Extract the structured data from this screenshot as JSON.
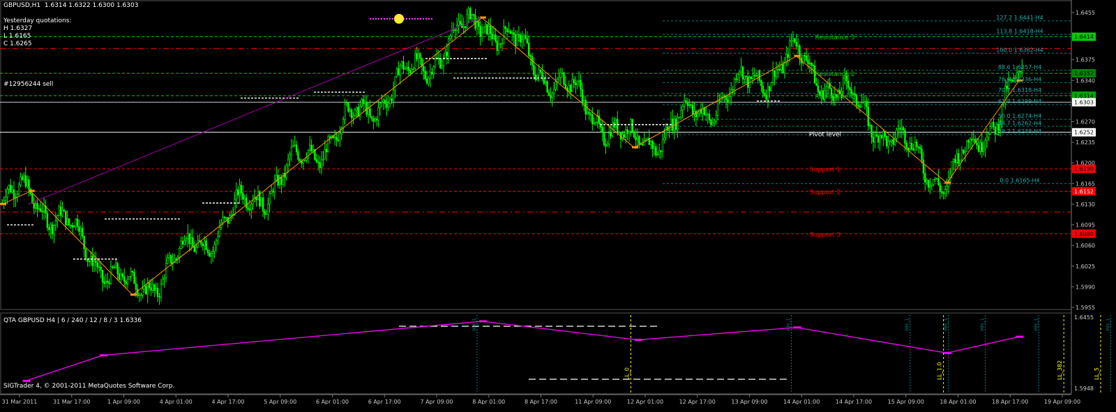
{
  "window": {
    "symbol_header": "GBPUSD,H1  1.6314 1.6322 1.6300 1.6303"
  },
  "yesterday": {
    "title": "Yesterday quotations:",
    "high": "H 1.6327",
    "low": "L 1.6165",
    "close": "C 1.6265"
  },
  "order": {
    "label": "#12956244 sell"
  },
  "colors": {
    "background": "#000000",
    "candle": "#00ff00",
    "zigzag": "#ff9900",
    "resistance": "#00cc00",
    "support": "#ff0000",
    "fib": "#008080",
    "qta_line": "#ff00ff",
    "cycle_yellow": "#ffff00"
  },
  "price_axis": {
    "ticks": [
      "1.6455",
      "1.6414",
      "1.6375",
      "1.6352",
      "1.6340",
      "1.6314",
      "1.6303",
      "1.6270",
      "1.6252",
      "1.6235",
      "1.6200",
      "1.6165",
      "1.6152",
      "1.6130",
      "1.6095",
      "1.6080",
      "1.6060",
      "1.6025",
      "1.5990",
      "1.5955"
    ],
    "highlighted": [
      {
        "value": "1.6414",
        "bg": "#00cc00",
        "fg": "#000000"
      },
      {
        "value": "1.6352",
        "bg": "#008800",
        "fg": "#000000"
      },
      {
        "value": "1.6314",
        "bg": "#00aa00",
        "fg": "#000000"
      },
      {
        "value": "1.6303",
        "bg": "#ffffff",
        "fg": "#000000"
      },
      {
        "value": "1.6252",
        "bg": "#ffffff",
        "fg": "#000000"
      },
      {
        "value": "1.6190",
        "bg": "#ff0000",
        "fg": "#000000"
      },
      {
        "value": "1.6152",
        "bg": "#ff0000",
        "fg": "#ffffff"
      },
      {
        "value": "1.6080",
        "bg": "#ff0000",
        "fg": "#000000"
      }
    ]
  },
  "levels": {
    "resistance": [
      {
        "label": "Resistance 3",
        "price": 1.6414
      },
      {
        "label": "Resistance 2",
        "price": 1.6352
      },
      {
        "label": "Resistance 1",
        "price": 1.6314
      }
    ],
    "pivot": {
      "label": "Pivot level",
      "price": 1.6252
    },
    "support": [
      {
        "label": "Support 1",
        "price": 1.619
      },
      {
        "label": "Support 2",
        "price": 1.6152
      },
      {
        "label": "Support 3",
        "price": 1.608
      }
    ],
    "yesterday_close_red": 1.6394,
    "yesterday_low_red": 1.6117
  },
  "fib": [
    {
      "label": "127.2 1.6441-H4",
      "price": 1.6441
    },
    {
      "label": "113.8 1.6418-H4",
      "price": 1.6418
    },
    {
      "label": "100.0 1.6382-H4",
      "price": 1.6386
    },
    {
      "label": "88.6 1.6357-H4",
      "price": 1.6357
    },
    {
      "label": "78.6 1.6336-H4",
      "price": 1.6336
    },
    {
      "label": "70.7 1.6318-H4",
      "price": 1.6318
    },
    {
      "label": "61.8 1.6299-H4",
      "price": 1.6299
    },
    {
      "label": "50.0 1.6274-H4",
      "price": 1.6274
    },
    {
      "label": "44.7 1.6262-H4",
      "price": 1.6262
    },
    {
      "label": "38.2 1.6248-H4",
      "price": 1.6248
    },
    {
      "label": "0.0 1.6165-H4",
      "price": 1.6165
    }
  ],
  "zigzag": [
    {
      "bar": 0,
      "price": 1.613
    },
    {
      "bar": 17,
      "price": 1.6152
    },
    {
      "bar": 78,
      "price": 1.5976
    },
    {
      "bar": 287,
      "price": 1.6446
    },
    {
      "bar": 378,
      "price": 1.6226
    },
    {
      "bar": 475,
      "price": 1.6381
    },
    {
      "bar": 565,
      "price": 1.6166
    },
    {
      "bar": 608,
      "price": 1.6339
    }
  ],
  "qta": {
    "label": "QTA GBPUSD H4 | 6 / 240 / 12 / 8 / 3 1.6336",
    "price_top": "1.6455",
    "price_bottom": "1.5948",
    "points": [
      {
        "bar": 14,
        "level": 0.85
      },
      {
        "bar": 60,
        "level": 0.52
      },
      {
        "bar": 287,
        "level": 0.08
      },
      {
        "bar": 380,
        "level": 0.32
      },
      {
        "bar": 475,
        "level": 0.16
      },
      {
        "bar": 565,
        "level": 0.49
      },
      {
        "bar": 608,
        "level": 0.28
      }
    ],
    "cycle_labels": [
      {
        "text": "LL_0",
        "bar": 376
      },
      {
        "text": "LL_1.0",
        "bar": 563
      },
      {
        "text": "LL_382",
        "bar": 635
      },
      {
        "text": "LL_5",
        "bar": 657
      },
      {
        "text": "LL_618",
        "bar": 679
      },
      {
        "text": "LL_786",
        "bar": 709
      },
      {
        "text": "LL_886",
        "bar": 730
      },
      {
        "text": "LL_1.0",
        "bar": 752
      }
    ],
    "hh_labels": [
      {
        "text": "HH_1",
        "bar": 284
      },
      {
        "text": "HH_1",
        "bar": 472
      },
      {
        "text": "HH_1",
        "bar": 543
      },
      {
        "text": "HH_1",
        "bar": 566
      },
      {
        "text": "HH_1",
        "bar": 588
      },
      {
        "text": "HH_1",
        "bar": 620
      },
      {
        "text": "HH_1",
        "bar": 663
      },
      {
        "text": "HH_1",
        "bar": 711
      }
    ]
  },
  "copyright": "SIGTrader 4, © 2001-2011 MetaQuotes Software Corp.",
  "time_axis": [
    "31 Mar 2011",
    "31 Mar 17:00",
    "1 Apr 09:00",
    "4 Apr 01:00",
    "4 Apr 17:00",
    "5 Apr 09:00",
    "6 Apr 01:00",
    "6 Apr 17:00",
    "7 Apr 09:00",
    "8 Apr 01:00",
    "8 Apr 17:00",
    "11 Apr 09:00",
    "12 Apr 01:00",
    "12 Apr 17:00",
    "13 Apr 09:00",
    "14 Apr 01:00",
    "14 Apr 17:00",
    "15 Apr 09:00",
    "18 Apr 01:00",
    "18 Apr 17:00",
    "19 Apr 09:00"
  ]
}
